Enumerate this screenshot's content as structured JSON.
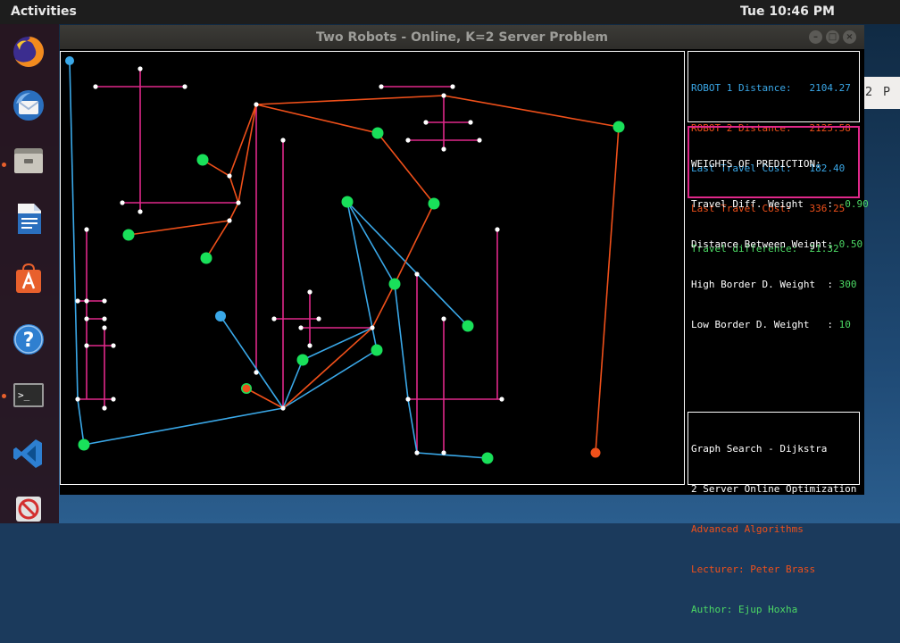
{
  "desktop": {
    "activities_label": "Activities",
    "clock": "Tue 10:46 PM",
    "background_window_tabs": [
      "2",
      "P"
    ]
  },
  "dock": {
    "items": [
      {
        "name": "firefox",
        "icon": "firefox-icon",
        "running": false
      },
      {
        "name": "thunderbird",
        "icon": "thunderbird-icon",
        "running": false
      },
      {
        "name": "files",
        "icon": "files-icon",
        "running": true
      },
      {
        "name": "writer",
        "icon": "libreoffice-writer-icon",
        "running": false
      },
      {
        "name": "software",
        "icon": "software-center-icon",
        "running": false
      },
      {
        "name": "help",
        "icon": "help-icon",
        "running": false
      },
      {
        "name": "terminal",
        "icon": "terminal-icon",
        "running": true
      },
      {
        "name": "vscode",
        "icon": "vscode-icon",
        "running": false
      },
      {
        "name": "app",
        "icon": "red-app-icon",
        "running": false
      }
    ]
  },
  "window": {
    "title": "Two Robots - Online, K=2 Server Problem"
  },
  "stats": {
    "robot1_distance_label": "ROBOT 1 Distance:",
    "robot1_distance_value": "2104.27",
    "robot2_distance_label": "ROBOT 2 Distance:",
    "robot2_distance_value": "2125.58",
    "last_travel_cost_1_label": "Last Travel Cost:",
    "last_travel_cost_1_value": "182.40",
    "last_travel_cost_2_label": "Last Travel Cost:",
    "last_travel_cost_2_value": "336.25",
    "travel_difference_label": "Travel difference:",
    "travel_difference_value": "21.32"
  },
  "weights": {
    "heading": "WEIGHTS OF PREDICTION:",
    "rows": [
      {
        "label": "Travel Diff. Weight    : ",
        "value": "-0.90"
      },
      {
        "label": "Distance Between Weight: ",
        "value": "0.50"
      },
      {
        "label": "High Border D. Weight  : ",
        "value": "300"
      },
      {
        "label": "Low Border D. Weight   : ",
        "value": "10"
      }
    ]
  },
  "info": {
    "line1": "Graph Search - Dijkstra",
    "line2": "2 Server Online Optimization",
    "line3": "Advanced Algorithms",
    "line4": "Lecturer: Peter Brass",
    "line5": "Author: Ejup Hoxha"
  },
  "colors": {
    "robot1": "#3aa8e8",
    "robot2": "#f0501a",
    "obstacle": "#e0288a",
    "request": "#19e05a",
    "node": "#ffffff",
    "label_green": "#4cd964",
    "label_white": "#ffffff"
  }
}
